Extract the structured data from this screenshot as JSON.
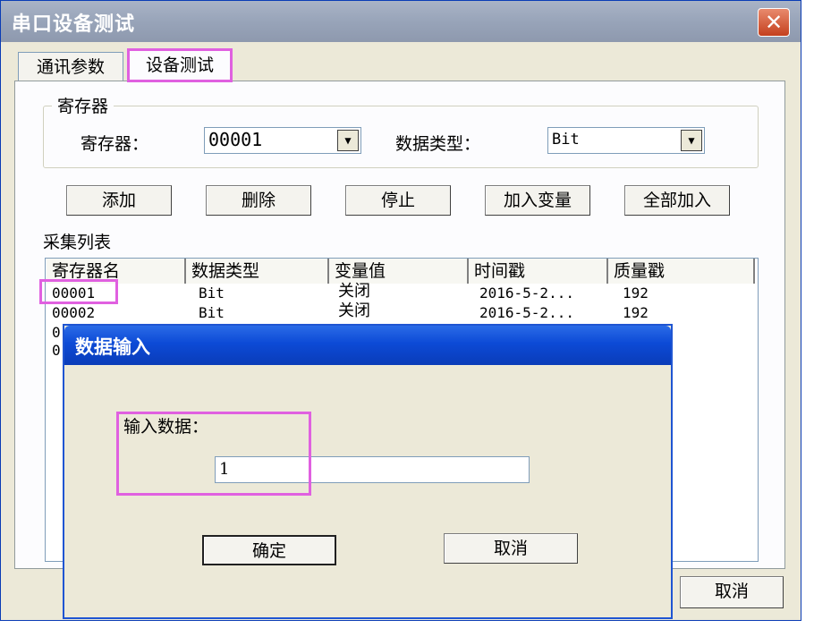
{
  "window": {
    "title": "串口设备测试",
    "close_label": "✕"
  },
  "tabs": [
    {
      "label": "通讯参数"
    },
    {
      "label": "设备测试"
    }
  ],
  "register_group": {
    "title": "寄存器",
    "register_label": "寄存器：",
    "register_value": "00001",
    "datatype_label": "数据类型：",
    "datatype_value": "Bit"
  },
  "buttons": {
    "add": "添加",
    "delete": "删除",
    "stop": "停止",
    "add_var": "加入变量",
    "add_all": "全部加入"
  },
  "list": {
    "title": "采集列表",
    "columns": [
      "寄存器名",
      "数据类型",
      "变量值",
      "时间戳",
      "质量戳"
    ],
    "rows": [
      {
        "name": "00001",
        "type": "Bit",
        "value": "关闭",
        "time": "2016-5-2...",
        "quality": "192"
      },
      {
        "name": "00002",
        "type": "Bit",
        "value": "关闭",
        "time": "2016-5-2...",
        "quality": "192"
      },
      {
        "name": "0"
      },
      {
        "name": "0"
      }
    ]
  },
  "footer": {
    "cancel": "取消"
  },
  "dialog": {
    "title": "数据输入",
    "input_label": "输入数据：",
    "input_value": "1",
    "ok": "确定",
    "cancel": "取消"
  }
}
